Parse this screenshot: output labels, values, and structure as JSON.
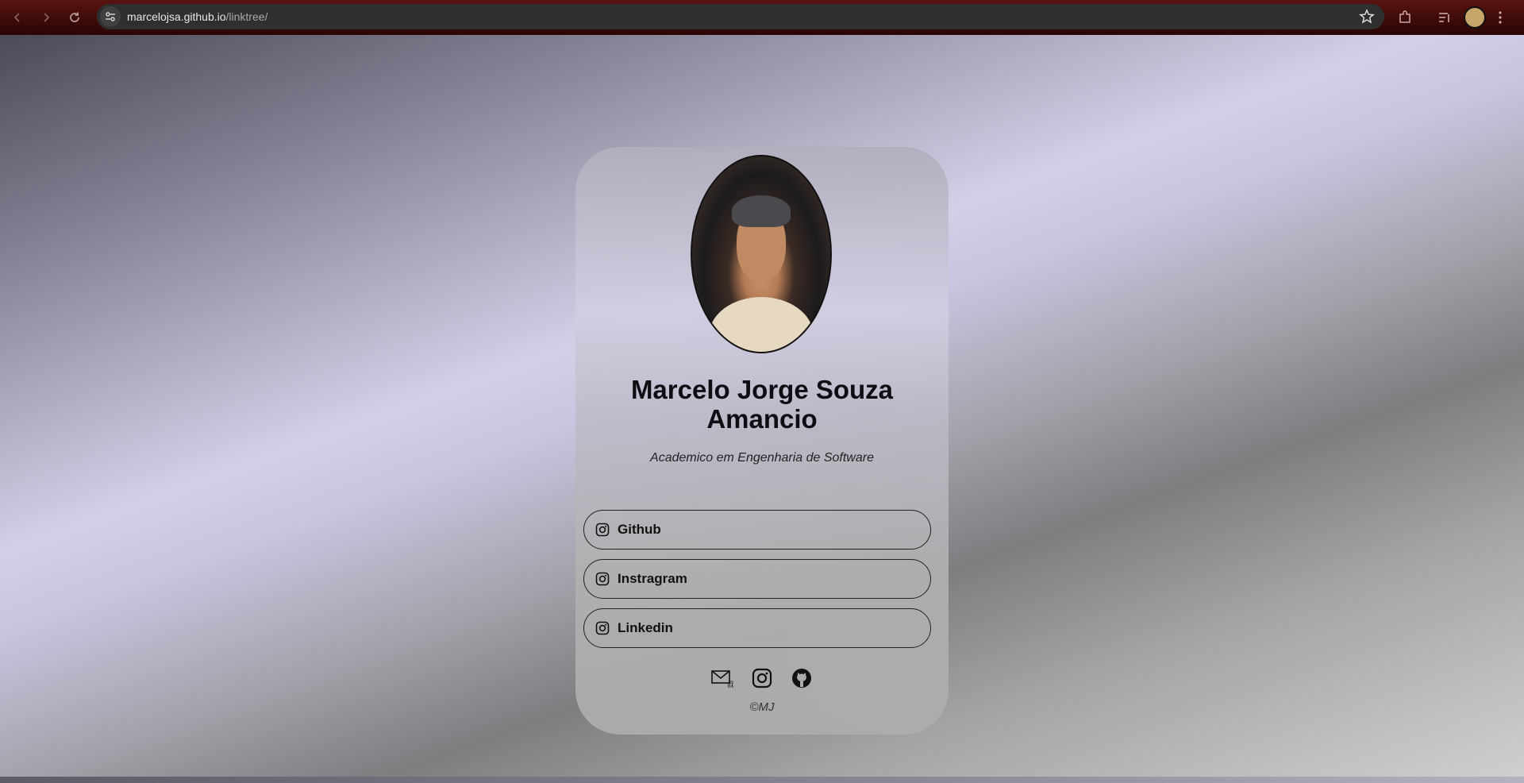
{
  "browser": {
    "url_host": "marcelojsa.github.io",
    "url_path": "/linktree/"
  },
  "profile": {
    "name": "Marcelo Jorge Souza Amancio",
    "subtitle": "Academico em Engenharia de Software"
  },
  "links": [
    {
      "label": "Github",
      "icon": "instagram-icon"
    },
    {
      "label": "Instragram",
      "icon": "instagram-icon"
    },
    {
      "label": "Linkedin",
      "icon": "instagram-icon"
    }
  ],
  "socials": [
    "email-icon",
    "instagram-icon",
    "github-icon"
  ],
  "footer": {
    "copyright": "©MJ"
  }
}
